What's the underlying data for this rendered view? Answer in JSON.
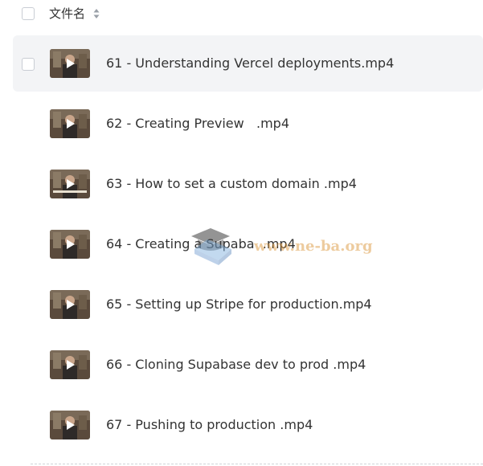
{
  "header": {
    "column_label": "文件名"
  },
  "files": [
    {
      "name": "61 - Understanding Vercel deployments.mp4"
    },
    {
      "name": "62 - Creating Preview   .mp4"
    },
    {
      "name": "63 - How to set a custom domain .mp4"
    },
    {
      "name": "64 - Creating a Supaba  .mp4"
    },
    {
      "name": "65 - Setting up Stripe for production.mp4"
    },
    {
      "name": "66 - Cloning Supabase dev to prod .mp4"
    },
    {
      "name": "67 - Pushing to production .mp4"
    }
  ],
  "watermark": {
    "text": "www.ne-ba.org"
  },
  "colors": {
    "hover_row": "#f3f4f6",
    "text": "#333333",
    "checkbox_border": "#c9cdd4"
  }
}
